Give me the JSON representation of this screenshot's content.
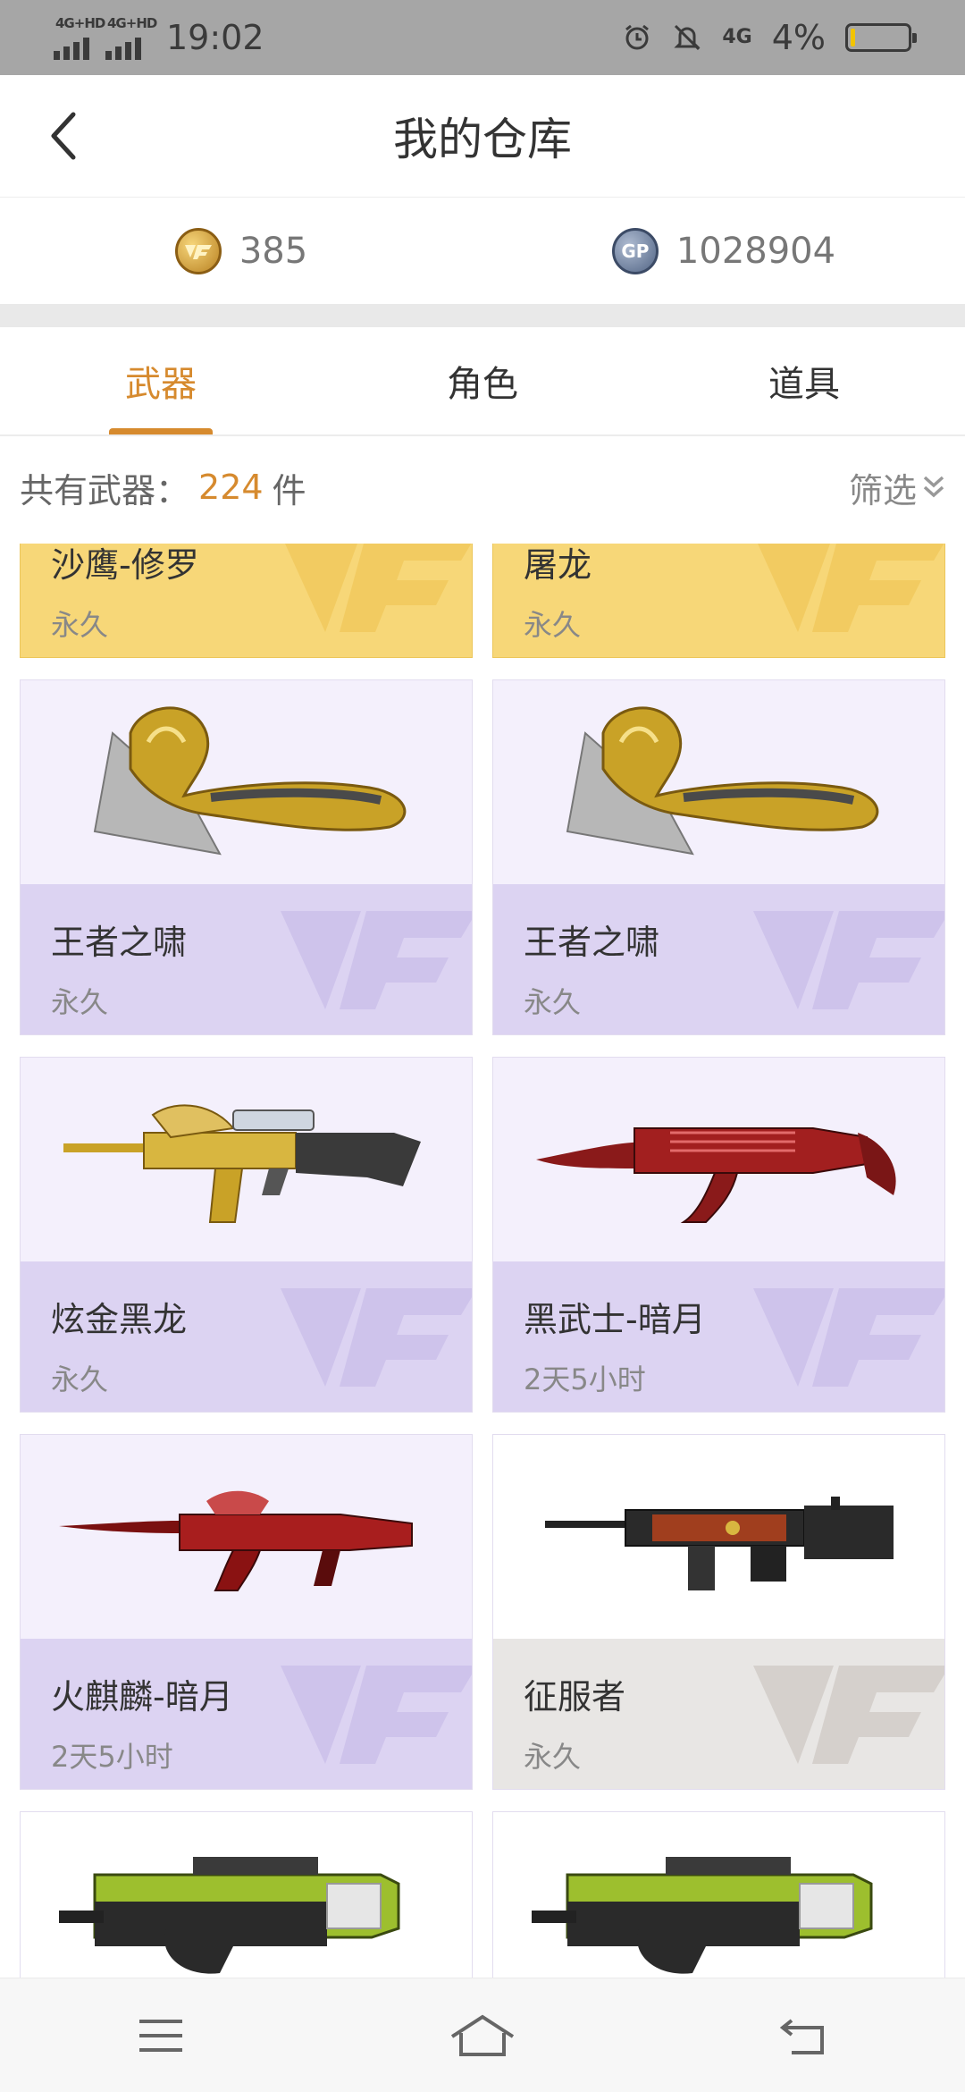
{
  "status_bar": {
    "net1": "4G+HD",
    "net2": "4G+HD",
    "time": "19:02",
    "net3": "4G",
    "battery": "4%",
    "battery_level": 0.04
  },
  "header": {
    "title": "我的仓库"
  },
  "currency": {
    "cf_points": "385",
    "gp_points": "1028904",
    "gp_badge": "GP"
  },
  "tabs": [
    {
      "label": "武器",
      "active": true
    },
    {
      "label": "角色",
      "active": false
    },
    {
      "label": "道具",
      "active": false
    }
  ],
  "summary": {
    "label": "共有武器：",
    "count": "224",
    "unit": "件",
    "filter": "筛选"
  },
  "items": [
    {
      "name": "沙鹰-修罗",
      "duration": "永久",
      "style": "gold"
    },
    {
      "name": "屠龙",
      "duration": "永久",
      "style": "gold"
    },
    {
      "name": "王者之啸",
      "duration": "永久",
      "style": "purple",
      "icon": "golden-axe-icon"
    },
    {
      "name": "王者之啸",
      "duration": "永久",
      "style": "purple",
      "icon": "golden-axe-icon"
    },
    {
      "name": "炫金黑龙",
      "duration": "永久",
      "style": "purple",
      "icon": "gold-rifle-icon"
    },
    {
      "name": "黑武士-暗月",
      "duration": "2天5小时",
      "style": "purple",
      "icon": "red-rifle-icon"
    },
    {
      "name": "火麒麟-暗月",
      "duration": "2天5小时",
      "style": "purple",
      "icon": "red-ak-icon"
    },
    {
      "name": "征服者",
      "duration": "永久",
      "style": "gray",
      "icon": "dark-rifle-icon"
    },
    {
      "name": "",
      "duration": "",
      "style": "white",
      "icon": "green-smg-icon"
    },
    {
      "name": "",
      "duration": "",
      "style": "white",
      "icon": "green-smg-icon"
    }
  ],
  "colors": {
    "accent": "#d68a2e",
    "purple_card": "#dcd3f2",
    "gold_card": "#f7d778",
    "gray_card": "#e8e6e4"
  }
}
